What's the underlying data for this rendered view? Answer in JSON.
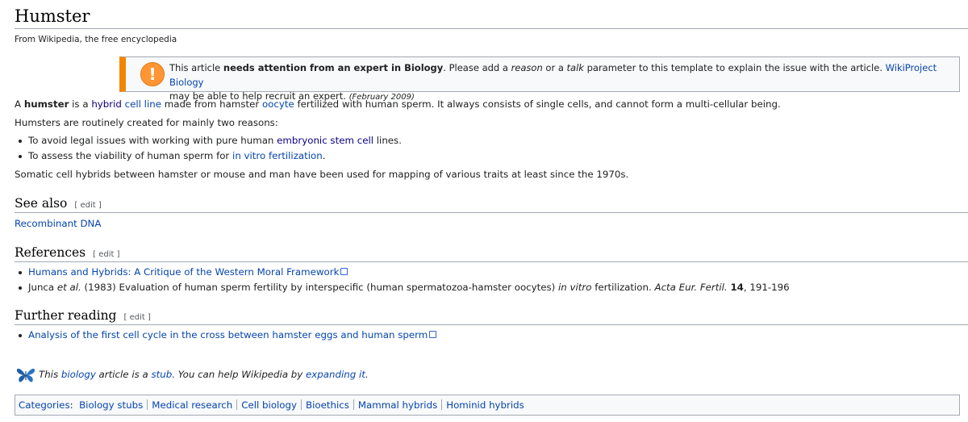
{
  "page": {
    "title": "Humster",
    "tagline": "From Wikipedia, the free encyclopedia"
  },
  "ambox": {
    "icon": "warning-exclamation-icon",
    "icon_glyph": "!",
    "t1": "This article ",
    "t2": "needs attention from an expert in Biology",
    "t3": ". Please add a ",
    "t4": "reason",
    "t5": " or a ",
    "t6": "talk",
    "t7": " parameter to this template to explain the issue with the article. ",
    "link": "WikiProject Biology",
    "t8": "may be able to help recruit an expert. ",
    "date": "(February 2009)"
  },
  "intro": {
    "p1_a": "A ",
    "p1_b": "humster",
    "p1_c": " is a ",
    "p1_link1": "hybrid",
    "p1_link2": "cell line",
    "p1_d": " made from hamster ",
    "p1_link3": "oocyte",
    "p1_e": " fertilized with human sperm. It always consists of single cells, and cannot form a multi-cellular being.",
    "p2": "Humsters are routinely created for mainly two reasons:",
    "b1_a": "To avoid legal issues with working with pure human ",
    "b1_link": "embryonic stem cell",
    "b1_b": " lines.",
    "b2_a": "To assess the viability of human sperm for ",
    "b2_link": "in vitro fertilization",
    "b2_b": ".",
    "p3": "Somatic cell hybrids between hamster or mouse and man have been used for mapping of various traits at least since the 1970s."
  },
  "see_also": {
    "heading": "See also",
    "edit": "[ edit ]",
    "item": "Recombinant DNA"
  },
  "references": {
    "heading": "References",
    "edit": "[ edit ]",
    "r1": "Humans and Hybrids: A Critique of the Western Moral Framework",
    "r2_a": "Junca ",
    "r2_b": "et al.",
    "r2_c": " (1983) Evaluation of human sperm fertility by interspecific (human spermatozoa-hamster oocytes) ",
    "r2_d": "in vitro",
    "r2_e": " fertilization. ",
    "r2_f": "Acta Eur. Fertil.",
    "r2_g": " ",
    "r2_h": "14",
    "r2_i": ", 191-196"
  },
  "further_reading": {
    "heading": "Further reading",
    "edit": "[ edit ]",
    "item": "Analysis of the first cell cycle in the cross between hamster eggs and human sperm"
  },
  "stub": {
    "icon": "butterfly-icon",
    "a": "This ",
    "link1": "biology",
    "b": " article is a ",
    "link2": "stub",
    "c": ". You can help Wikipedia by ",
    "link3": "expanding it",
    "d": "."
  },
  "categories": {
    "label": "Categories",
    "colon": ":",
    "items": [
      "Biology stubs",
      "Medical research",
      "Cell biology",
      "Bioethics",
      "Mammal hybrids",
      "Hominid hybrids"
    ]
  },
  "colors": {
    "link": "#0645ad",
    "visited": "#0b0080",
    "warning_orange": "#f28500",
    "border": "#a2a9b1"
  }
}
